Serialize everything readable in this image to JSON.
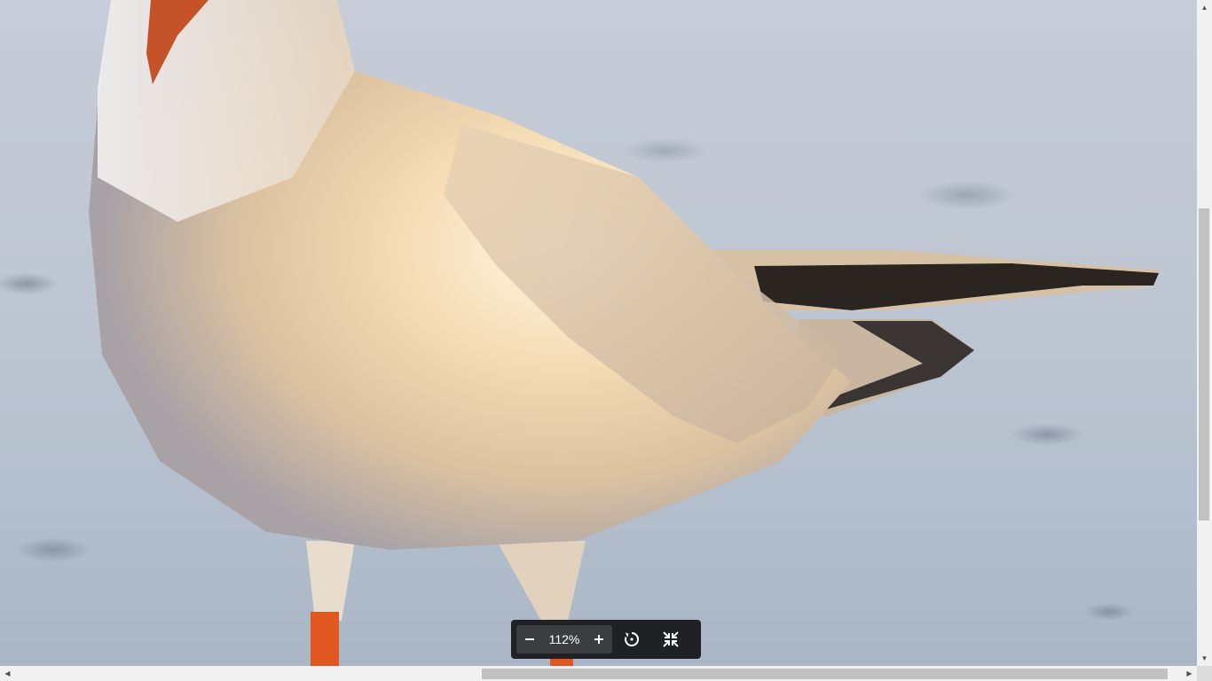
{
  "image_viewer": {
    "subject_icon": "gull-photo",
    "zoom": {
      "value": "112%",
      "zoom_out_icon": "minus-icon",
      "zoom_in_icon": "plus-icon"
    },
    "rotate_icon": "rotate-icon",
    "fit_icon": "shrink-to-fit-icon"
  },
  "scrollbars": {
    "vertical_up": "▲",
    "vertical_down": "▼",
    "horizontal_left": "◀",
    "horizontal_right": "▶"
  },
  "colors": {
    "toolbar_bg": "#202124",
    "zoom_group_bg": "#3c3d40",
    "scrollbar_track": "#f1f1f1",
    "scrollbar_thumb": "#c1c1c1"
  }
}
